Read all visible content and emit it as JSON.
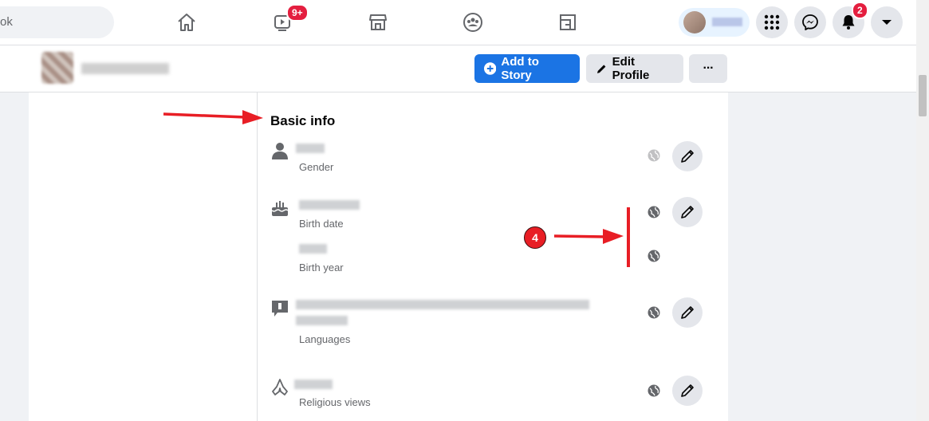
{
  "topnav": {
    "search_text": "ok",
    "watch_badge": "9+",
    "notifications_badge": "2"
  },
  "profile_header": {
    "add_story_label": "Add to Story",
    "edit_profile_label": "Edit Profile",
    "more_label": "···"
  },
  "basic_info": {
    "title": "Basic info",
    "rows": [
      {
        "label": "Gender"
      },
      {
        "label": "Birth date"
      },
      {
        "label": "Birth year"
      },
      {
        "label": "Languages"
      },
      {
        "label": "Religious views"
      }
    ]
  },
  "annotation": {
    "step_number": "4",
    "color": "#e81e25"
  },
  "colors": {
    "brand_blue": "#1b74e4",
    "badge_red": "#e41e3f"
  }
}
